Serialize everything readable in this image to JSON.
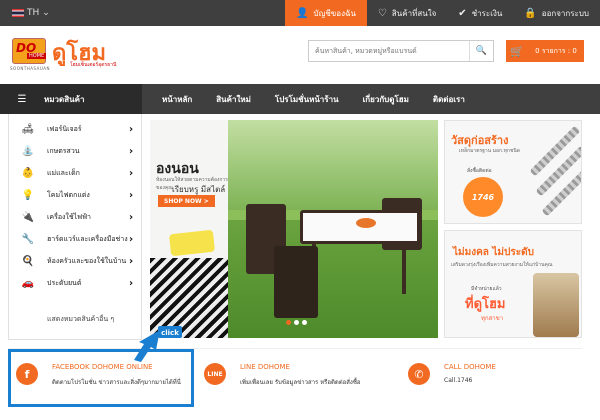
{
  "topbar": {
    "language": "TH",
    "links": [
      {
        "label": "บัญชีของฉัน",
        "icon": "user-icon",
        "active": true
      },
      {
        "label": "สินค้าที่สนใจ",
        "icon": "heart-icon",
        "active": false
      },
      {
        "label": "ชำระเงิน",
        "icon": "check-icon",
        "active": false
      },
      {
        "label": "ออกจากระบบ",
        "icon": "lock-icon",
        "active": false
      }
    ]
  },
  "header": {
    "logo_do": "DO",
    "logo_home": "HOME",
    "logo_sub": "SOONTHASAUAN",
    "brand": "ดูโฮม",
    "brand_sub": "โฮมเซ็นเตอร์อุดรธานี",
    "search_placeholder": "ค้นหาสินค้า, หมวดหมู่หรือแบรนด์",
    "cart_label": "0 รายการ : 0"
  },
  "nav": {
    "menu_label": "หมวดสินค้า",
    "items": [
      "หน้าหลัก",
      "สินค้าใหม่",
      "โปรโมชั่นหน้าร้าน",
      "เกี่ยวกับดูโฮม",
      "ติดต่อเรา"
    ]
  },
  "sidebar": {
    "items": [
      {
        "label": "เฟอร์นิเจอร์",
        "icon": "sofa-icon"
      },
      {
        "label": "เกษตรสวน",
        "icon": "watering-can-icon"
      },
      {
        "label": "แม่และเด็ก",
        "icon": "baby-icon"
      },
      {
        "label": "โคมไฟตกแต่ง",
        "icon": "lamp-icon"
      },
      {
        "label": "เครื่องใช้ไฟฟ้า",
        "icon": "appliance-icon"
      },
      {
        "label": "ฮาร์ดแวร์และเครื่องมือช่าง",
        "icon": "tools-icon"
      },
      {
        "label": "ห้องครัวและของใช้ในบ้าน",
        "icon": "kitchen-icon"
      },
      {
        "label": "ประดับยนต์",
        "icon": "car-icon"
      }
    ],
    "all_label": "แสดงหมวดสินค้าอื่น ๆ"
  },
  "banner": {
    "title": "องนอน",
    "line1": "ห้องนอนให้สวยตามความต้องการของคุณ",
    "line2": "เรียบหรู มีสไตล์",
    "shop_now": "SHOP NOW >"
  },
  "ads": {
    "ad1_title": "วัสดุก่อสร้าง",
    "ad1_sub": "เหล็กมาตรฐาน มอก.ทุกชนิด",
    "ad1_order": "สั่งซื้อติดต่อ",
    "ad1_phone": "1746",
    "ad2_title": "ไม่มงคล ไม่ประดับ",
    "ad2_sub": "เสริมดวงรุ่งเรืองเพิ่มความสวยงามให้แก่บ้านคุณ",
    "ad2_pre": "มีจำหน่ายแล้ว",
    "ad2_big": "ที่ดูโฮม",
    "ad2_branch": "ทุกสาขา"
  },
  "contacts": [
    {
      "icon_text": "f",
      "title": "FACEBOOK DOHOME ONLINE",
      "desc": "ติดตามโปรโมชั่น ข่าวสารและสิ่งดีๆมากมายได้ที่นี่"
    },
    {
      "icon_text": "LINE",
      "title": "LINE DOHOME",
      "desc": "เพิ่มเพื่อนเลย รับข้อมูลข่าวสาร หรือติดต่อสั่งซื้อ"
    },
    {
      "icon_text": "✆",
      "title": "CALL DOHOME",
      "desc": "Call.1746"
    }
  ],
  "click_badge": "click",
  "colors": {
    "accent": "#f26a21",
    "dark_bar": "#3f3f3f",
    "highlight": "#1a7fd1"
  }
}
